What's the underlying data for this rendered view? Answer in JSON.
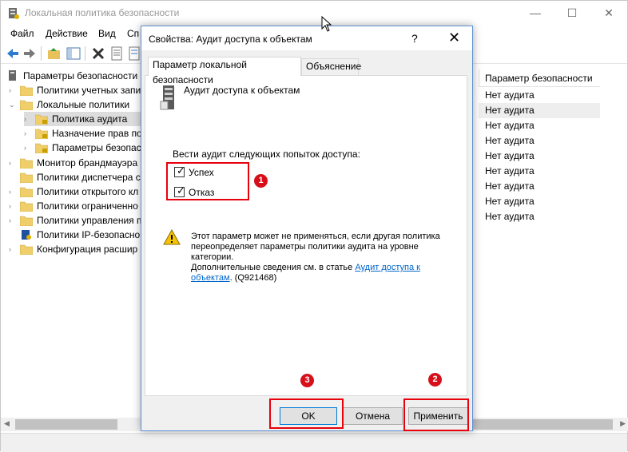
{
  "main_window": {
    "title": "Локальная политика безопасности",
    "controls": {
      "minimize": "—",
      "maximize": "☐",
      "close": "✕"
    }
  },
  "menu": [
    "Файл",
    "Действие",
    "Вид",
    "Сп"
  ],
  "tree": {
    "root": "Параметры безопасности",
    "items": [
      "Политики учетных запи",
      "Локальные политики",
      "Политика аудита",
      "Назначение прав по",
      "Параметры безопасн",
      "Монитор брандмауэра",
      "Политики диспетчера с",
      "Политики открытого кл",
      "Политики ограниченно",
      "Политики управления п",
      "Политики IP-безопасно",
      "Конфигурация расшир"
    ]
  },
  "list": {
    "header": "Параметр безопасности",
    "values": [
      "Нет аудита",
      "Нет аудита",
      "Нет аудита",
      "Нет аудита",
      "Нет аудита",
      "Нет аудита",
      "Нет аудита",
      "Нет аудита",
      "Нет аудита"
    ]
  },
  "dialog": {
    "title": "Свойства: Аудит доступа к объектам",
    "help": "?",
    "close": "✕",
    "tabs": [
      "Параметр локальной безопасности",
      "Объяснение"
    ],
    "policy_name": "Аудит доступа к объектам",
    "audit_label": "Вести аудит следующих попыток доступа:",
    "checkboxes": [
      {
        "label": "Успех",
        "checked": true
      },
      {
        "label": "Отказ",
        "checked": true
      }
    ],
    "check_mark": "✓",
    "warning": {
      "line1": "Этот параметр может не применяться, если другая политика",
      "line2": "переопределяет параметры политики аудита на уровне",
      "line3": "категории.",
      "line4_prefix": "Дополнительные сведения см. в статье ",
      "link_part1": "Аудит доступа к",
      "link_part2": "объектам",
      "suffix": ". (Q921468)"
    },
    "buttons": {
      "ok": "OK",
      "cancel": "Отмена",
      "apply": "Применить"
    }
  },
  "annotations": {
    "markers": [
      "1",
      "2",
      "3"
    ],
    "color": "#e8000b"
  }
}
